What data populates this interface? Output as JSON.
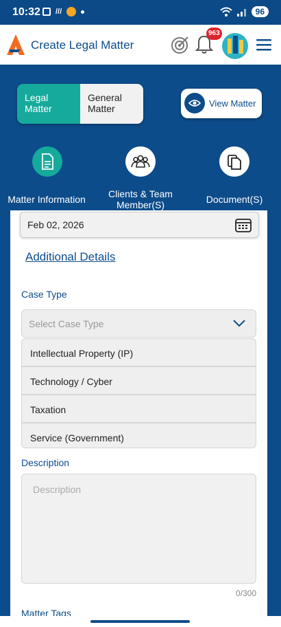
{
  "status_bar": {
    "time": "10:32",
    "battery": "96"
  },
  "header": {
    "title": "Create Legal Matter",
    "notification_count": "963",
    "icons": [
      "target-icon",
      "bell-icon",
      "menu-icon"
    ]
  },
  "segment": {
    "active": "Legal\nMatter",
    "inactive": "General\nMatter"
  },
  "view_button": {
    "label": "View Matter"
  },
  "steps": [
    {
      "label": "Matter Information",
      "icon": "document-icon",
      "active": true
    },
    {
      "label": "Clients & Team\nMember(S)",
      "icon": "people-icon",
      "active": false
    },
    {
      "label": "Document(S)",
      "icon": "copy-icon",
      "active": false
    }
  ],
  "form": {
    "date_value": "Feb 02, 2026",
    "additional_details": "Additional Details",
    "case_type_label": "Case Type",
    "case_type_placeholder": "Select Case Type",
    "case_type_options": [
      "Intellectual Property (IP)",
      "Technology / Cyber",
      "Taxation",
      "Service (Government)"
    ],
    "description_label": "Description",
    "description_placeholder": "Description",
    "description_counter": "0/300",
    "matter_tags_label": "Matter Tags"
  },
  "colors": {
    "primary": "#0d4c8a",
    "accent": "#16aa9c",
    "badge": "#e0222c"
  }
}
